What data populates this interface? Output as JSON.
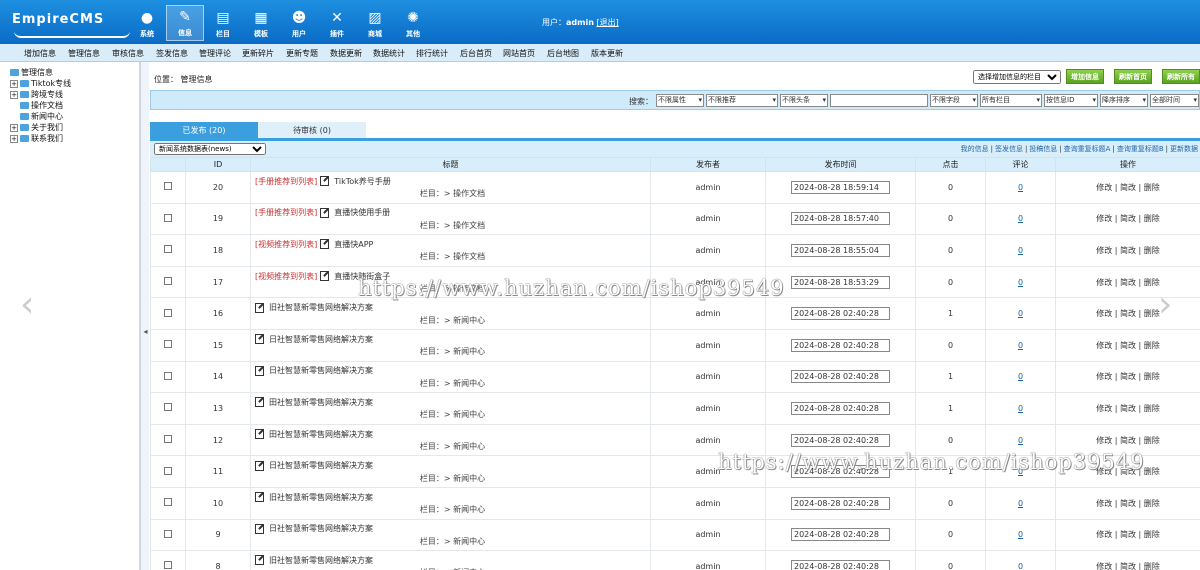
{
  "app": {
    "logo": "EmpireCMS"
  },
  "main_nav": [
    {
      "label": "系统",
      "icon": "system-icon"
    },
    {
      "label": "信息",
      "icon": "info-icon",
      "active": true
    },
    {
      "label": "栏目",
      "icon": "column-icon"
    },
    {
      "label": "模板",
      "icon": "template-icon"
    },
    {
      "label": "用户",
      "icon": "user-icon"
    },
    {
      "label": "插件",
      "icon": "plugin-icon"
    },
    {
      "label": "商城",
      "icon": "shop-icon"
    },
    {
      "label": "其他",
      "icon": "gear-icon"
    }
  ],
  "user": {
    "prefix": "用户：",
    "name": "admin",
    "logout": "[退出]"
  },
  "sub_nav": [
    "增加信息",
    "管理信息",
    "审核信息",
    "签发信息",
    "管理评论",
    "更新碎片",
    "更新专题",
    "数据更新",
    "数据统计",
    "排行统计",
    "后台首页",
    "网站首页",
    "后台地图",
    "版本更新"
  ],
  "tree": [
    {
      "label": "管理信息",
      "level": 0
    },
    {
      "label": "Tiktok专线",
      "level": 1
    },
    {
      "label": "跨境专线",
      "level": 1
    },
    {
      "label": "操作文档",
      "level": 2
    },
    {
      "label": "新闻中心",
      "level": 2
    },
    {
      "label": "关于我们",
      "level": 1
    },
    {
      "label": "联系我们",
      "level": 1
    }
  ],
  "location": {
    "label": "位置：",
    "path": "管理信息"
  },
  "actions": {
    "column_select": "选择增加信息的栏目",
    "add_info": "增加信息",
    "refresh_home": "刷新首页",
    "refresh_all": "刷新所有"
  },
  "search": {
    "label": "搜索：",
    "selects": [
      "不限属性",
      "不限推荐",
      "不限头条",
      "不限字段",
      "所有栏目",
      "按信息ID",
      "降序排序",
      "全部时间"
    ]
  },
  "tabs": {
    "published": "已发布 (20)",
    "pending": "待审核 (0)"
  },
  "table_select": "新闻系统数据表(news)",
  "quick_links": [
    "我的信息",
    "签发信息",
    "投稿信息",
    "查询重复标题A",
    "查询重复标题B",
    "更新数据"
  ],
  "columns": [
    "ID",
    "标题",
    "发布者",
    "发布时间",
    "点击",
    "评论",
    "操作"
  ],
  "rows": [
    {
      "id": "20",
      "tag": "[手册推荐到列表]",
      "title": "TikTok养号手册",
      "column": "栏目：> 操作文档",
      "author": "admin",
      "time": "2024-08-28 18:59:14",
      "clicks": "0",
      "comments": "0"
    },
    {
      "id": "19",
      "tag": "[手册推荐到列表]",
      "title": "直播快使用手册",
      "column": "栏目：> 操作文档",
      "author": "admin",
      "time": "2024-08-28 18:57:40",
      "clicks": "0",
      "comments": "0"
    },
    {
      "id": "18",
      "tag": "[视频推荐到列表]",
      "title": "直播快APP",
      "column": "栏目：> 操作文档",
      "author": "admin",
      "time": "2024-08-28 18:55:04",
      "clicks": "0",
      "comments": "0"
    },
    {
      "id": "17",
      "tag": "[视频推荐到列表]",
      "title": "直播快随街盒子",
      "column": "栏目：> 操作文档",
      "author": "admin",
      "time": "2024-08-28 18:53:29",
      "clicks": "0",
      "comments": "0"
    },
    {
      "id": "16",
      "tag": "",
      "title": "旧社智慧新零售网络解决方案",
      "column": "栏目：> 新闻中心",
      "author": "admin",
      "time": "2024-08-28 02:40:28",
      "clicks": "1",
      "comments": "0"
    },
    {
      "id": "15",
      "tag": "",
      "title": "日社智慧新零售网络解决方案",
      "column": "栏目：> 新闻中心",
      "author": "admin",
      "time": "2024-08-28 02:40:28",
      "clicks": "0",
      "comments": "0"
    },
    {
      "id": "14",
      "tag": "",
      "title": "日社智慧新零售网络解决方案",
      "column": "栏目：> 新闻中心",
      "author": "admin",
      "time": "2024-08-28 02:40:28",
      "clicks": "1",
      "comments": "0"
    },
    {
      "id": "13",
      "tag": "",
      "title": "田社智慧新零售网络解决方案",
      "column": "栏目：> 新闻中心",
      "author": "admin",
      "time": "2024-08-28 02:40:28",
      "clicks": "1",
      "comments": "0"
    },
    {
      "id": "12",
      "tag": "",
      "title": "田社智慧新零售网络解决方案",
      "column": "栏目：> 新闻中心",
      "author": "admin",
      "time": "2024-08-28 02:40:28",
      "clicks": "0",
      "comments": "0"
    },
    {
      "id": "11",
      "tag": "",
      "title": "日社智慧新零售网络解决方案",
      "column": "栏目：> 新闻中心",
      "author": "admin",
      "time": "2024-08-28 02:40:28",
      "clicks": "1",
      "comments": "0"
    },
    {
      "id": "10",
      "tag": "",
      "title": "旧社智慧新零售网络解决方案",
      "column": "栏目：> 新闻中心",
      "author": "admin",
      "time": "2024-08-28 02:40:28",
      "clicks": "0",
      "comments": "0"
    },
    {
      "id": "9",
      "tag": "",
      "title": "日社智慧新零售网络解决方案",
      "column": "栏目：> 新闻中心",
      "author": "admin",
      "time": "2024-08-28 02:40:28",
      "clicks": "0",
      "comments": "0"
    },
    {
      "id": "8",
      "tag": "",
      "title": "旧社智慧新零售网络解决方案",
      "column": "栏目：> 新闻中心",
      "author": "admin",
      "time": "2024-08-28 02:40:28",
      "clicks": "0",
      "comments": "0"
    }
  ],
  "row_ops": [
    "修改",
    "简改",
    "删除"
  ],
  "watermark": "https://www.huzhan.com/ishop39549",
  "colors": {
    "header": "#1e8fe0",
    "accent": "#3b9ede",
    "tag_red": "#c83232",
    "green_button": "#5aa31e"
  }
}
